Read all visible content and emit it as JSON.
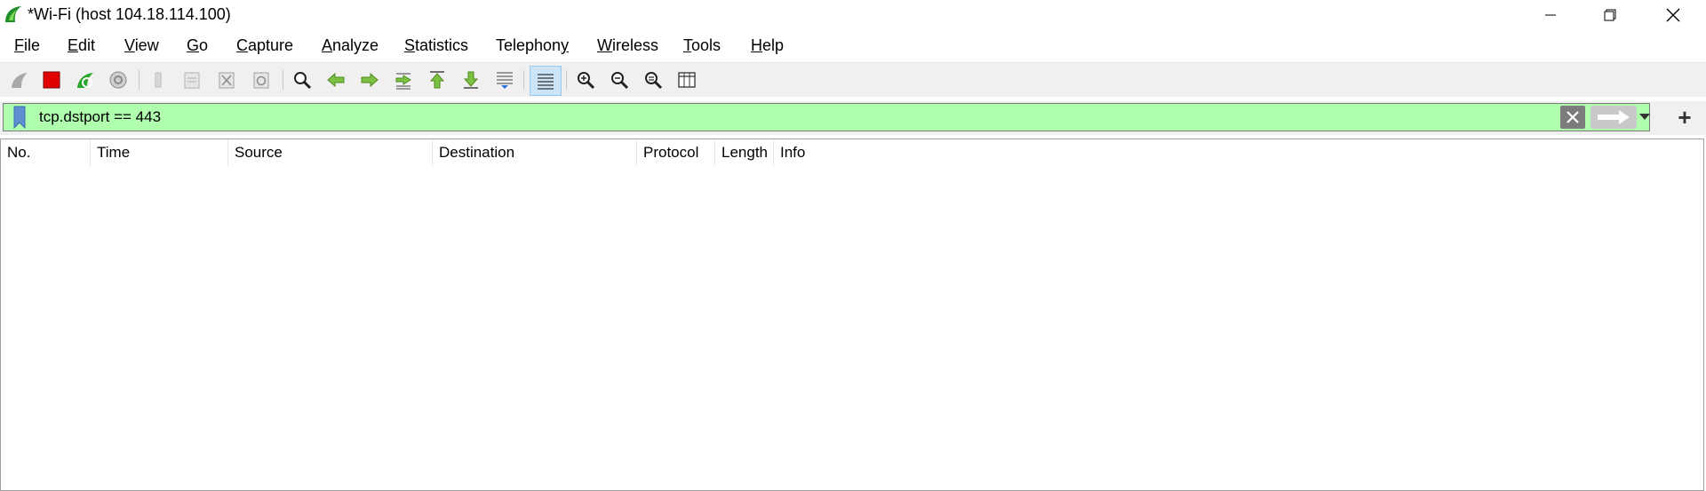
{
  "window": {
    "title": "*Wi-Fi (host 104.18.114.100)",
    "icon": "wireshark-fin-icon",
    "controls": [
      "minimize-icon",
      "maximize-icon",
      "close-icon"
    ]
  },
  "menu": [
    {
      "label": "File",
      "mnemonic": "F",
      "rest": "ile"
    },
    {
      "label": "Edit",
      "mnemonic": "E",
      "rest": "dit"
    },
    {
      "label": "View",
      "mnemonic": "V",
      "rest": "iew"
    },
    {
      "label": "Go",
      "mnemonic": "G",
      "rest": "o"
    },
    {
      "label": "Capture",
      "mnemonic": "C",
      "rest": "apture"
    },
    {
      "label": "Analyze",
      "mnemonic": "A",
      "rest": "nalyze"
    },
    {
      "label": "Statistics",
      "mnemonic": "S",
      "rest": "tatistics"
    },
    {
      "label": "Telephony",
      "pre": "Telephon",
      "mnemonic": "y",
      "rest": ""
    },
    {
      "label": "Wireless",
      "mnemonic": "W",
      "rest": "ireless"
    },
    {
      "label": "Tools",
      "mnemonic": "T",
      "rest": "ools"
    },
    {
      "label": "Help",
      "mnemonic": "H",
      "rest": "elp"
    }
  ],
  "toolbar": {
    "icons": [
      "start-capture-icon",
      "stop-capture-icon",
      "restart-capture-icon",
      "capture-options-icon",
      "open-file-icon",
      "save-file-icon",
      "close-file-icon",
      "reload-file-icon",
      "find-packet-icon",
      "go-back-icon",
      "go-forward-icon",
      "go-to-packet-icon",
      "first-packet-icon",
      "last-packet-icon",
      "auto-scroll-icon",
      "colorize-icon",
      "zoom-in-icon",
      "zoom-out-icon",
      "normal-size-icon",
      "resize-columns-icon"
    ],
    "checked": "colorize-icon"
  },
  "filter": {
    "value": "tcp.dstport == 443",
    "background": "#afffaf",
    "add_label": "+"
  },
  "packet_list": {
    "columns": [
      "No.",
      "Time",
      "Source",
      "Destination",
      "Protocol",
      "Length",
      "Info"
    ],
    "rows": []
  }
}
